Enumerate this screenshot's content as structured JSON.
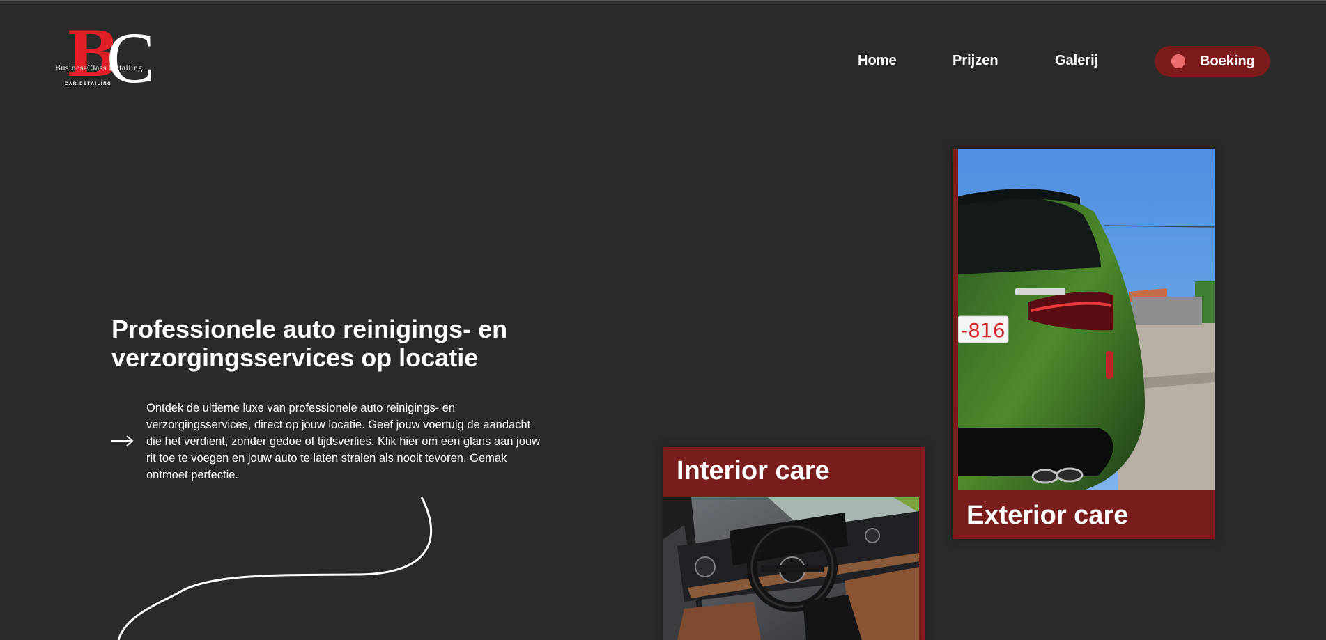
{
  "logo": {
    "letter_b": "B",
    "letter_c": "C",
    "name": "BusinessClass Detailing",
    "tagline": "CAR DETAILING"
  },
  "nav": {
    "items": [
      {
        "label": "Home"
      },
      {
        "label": "Prijzen"
      },
      {
        "label": "Galerij"
      }
    ],
    "booking_label": "Boeking"
  },
  "hero": {
    "title": "Professionele auto reinigings- en verzorgingsservices op locatie",
    "text": "Ontdek de ultieme luxe van professionele auto reinigings- en verzorgingsservices, direct op jouw locatie. Geef jouw voertuig de aandacht die het verdient, zonder gedoe of tijdsverlies. Klik hier om een glans aan jouw rit toe te voegen en jouw auto te laten stralen als nooit tevoren. Gemak ontmoet perfectie."
  },
  "cards": {
    "interior_title": "Interior care",
    "exterior_title": "Exterior care",
    "plate_text": "-816"
  },
  "icons": {
    "arrow": "arrow-right-icon",
    "booking_dot": "dot-icon"
  },
  "colors": {
    "background": "#2a2a2a",
    "accent": "#7a1d1d",
    "logo_red": "#e11f26",
    "booking_dot": "#eb6b6b"
  }
}
